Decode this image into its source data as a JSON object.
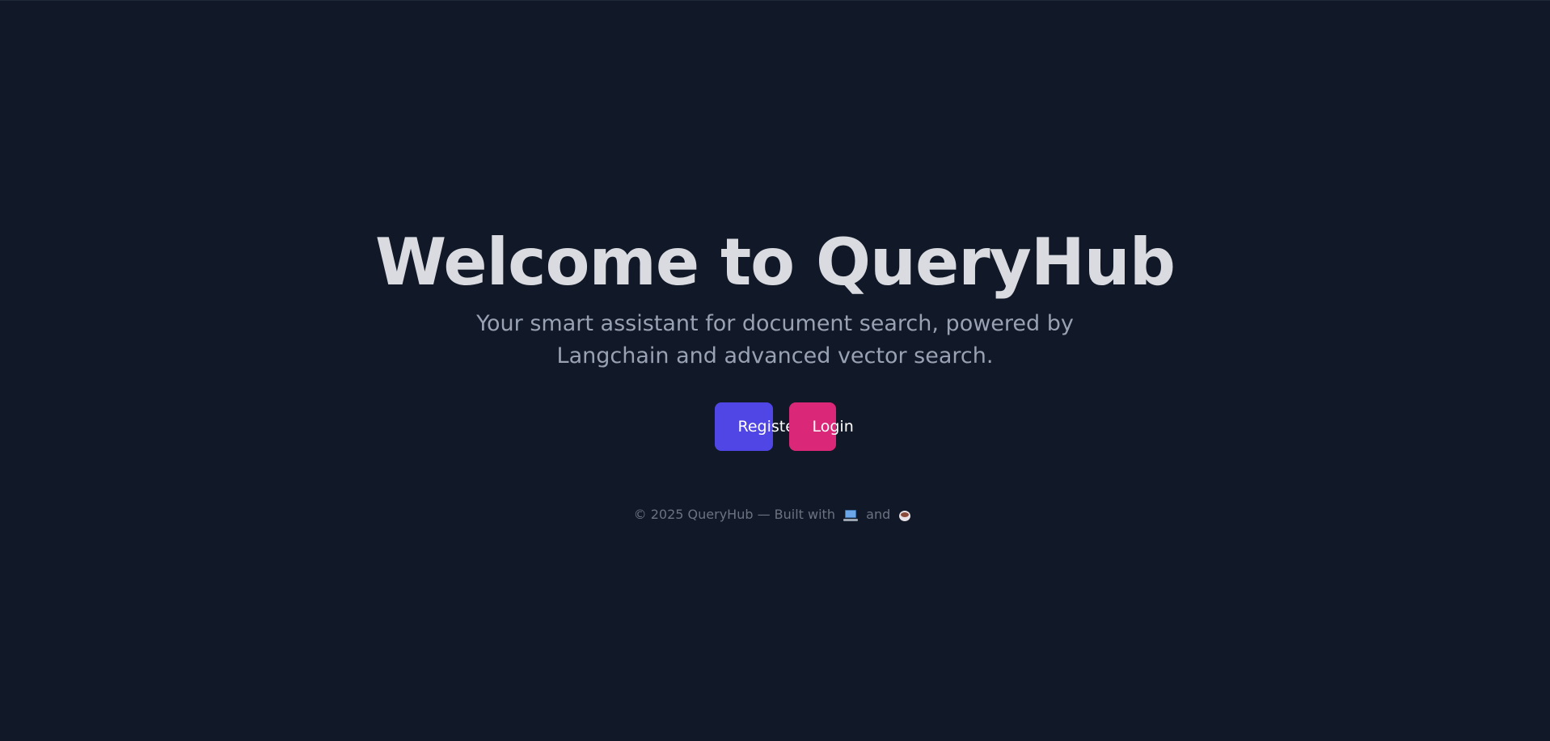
{
  "hero": {
    "title": "Welcome to QueryHub",
    "subtitle_line1": "Your smart assistant for document search, powered by",
    "subtitle_line2": "Langchain and advanced vector search."
  },
  "buttons": {
    "register_label": "Register",
    "login_label": "Login"
  },
  "footer": {
    "prefix": "© 2025 QueryHub — Built with",
    "joiner": "and",
    "icon_1": "laptop-icon",
    "icon_2": "coffee-icon"
  },
  "colors": {
    "background": "#111827",
    "register": "#4f46e5",
    "login": "#db2777",
    "title": "#d9dbe0",
    "subtitle": "#98a2b3",
    "footer": "#6b7280"
  }
}
